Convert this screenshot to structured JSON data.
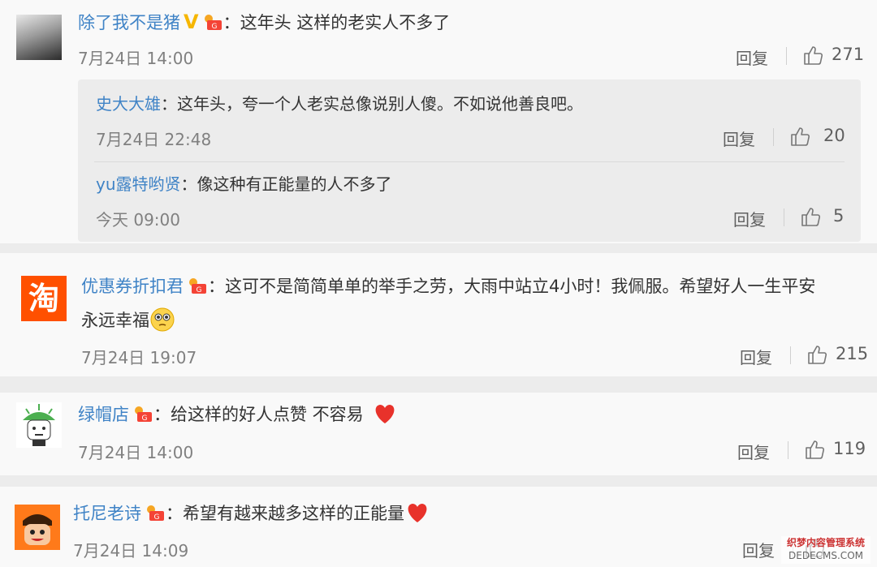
{
  "comments": [
    {
      "username": "除了我不是猪",
      "separator": "：",
      "text": "这年头 这样的老实人不多了",
      "time": "7月24日 14:00",
      "reply_label": "回复",
      "likes": "271",
      "replies": [
        {
          "username": "史大大雄",
          "separator": "：",
          "text": "这年头，夸一个人老实总像说别人傻。不如说他善良吧。",
          "time": "7月24日 22:48",
          "reply_label": "回复",
          "likes": "20"
        },
        {
          "username": "yu露特哟贤",
          "separator": "：",
          "text": "像这种有正能量的人不多了",
          "time": "今天 09:00",
          "reply_label": "回复",
          "likes": "5"
        }
      ]
    },
    {
      "username": "优惠券折扣君",
      "separator": "：",
      "text": "这可不是简简单单的举手之劳，大雨中站立4小时！我佩服。希望好人一生平安",
      "text2": "永远幸福",
      "time": "7月24日 19:07",
      "reply_label": "回复",
      "likes": "215",
      "avatar_char": "淘"
    },
    {
      "username": "绿帽店",
      "separator": "：",
      "text": "给这样的好人点赞  不容易",
      "time": "7月24日 14:00",
      "reply_label": "回复",
      "likes": "119"
    },
    {
      "username": "托尼老诗",
      "separator": "：",
      "text": "希望有越来越多这样的正能量",
      "time": "7月24日 14:09",
      "reply_label": "回复",
      "likes": ""
    }
  ],
  "icons": {
    "like": "thumbs-up-icon",
    "verified": "verified-v-icon",
    "fan_badge": "fan-badge-icon",
    "heart": "red-heart-emoji",
    "smile": "pleading-face-emoji"
  },
  "colors": {
    "username": "#3f83c6",
    "verified": "#f6b600",
    "heart": "#e8322b",
    "taobao": "#ff5000"
  },
  "watermark": {
    "line1": "织梦内容管理系统",
    "line2": "DEDECMS.COM"
  }
}
